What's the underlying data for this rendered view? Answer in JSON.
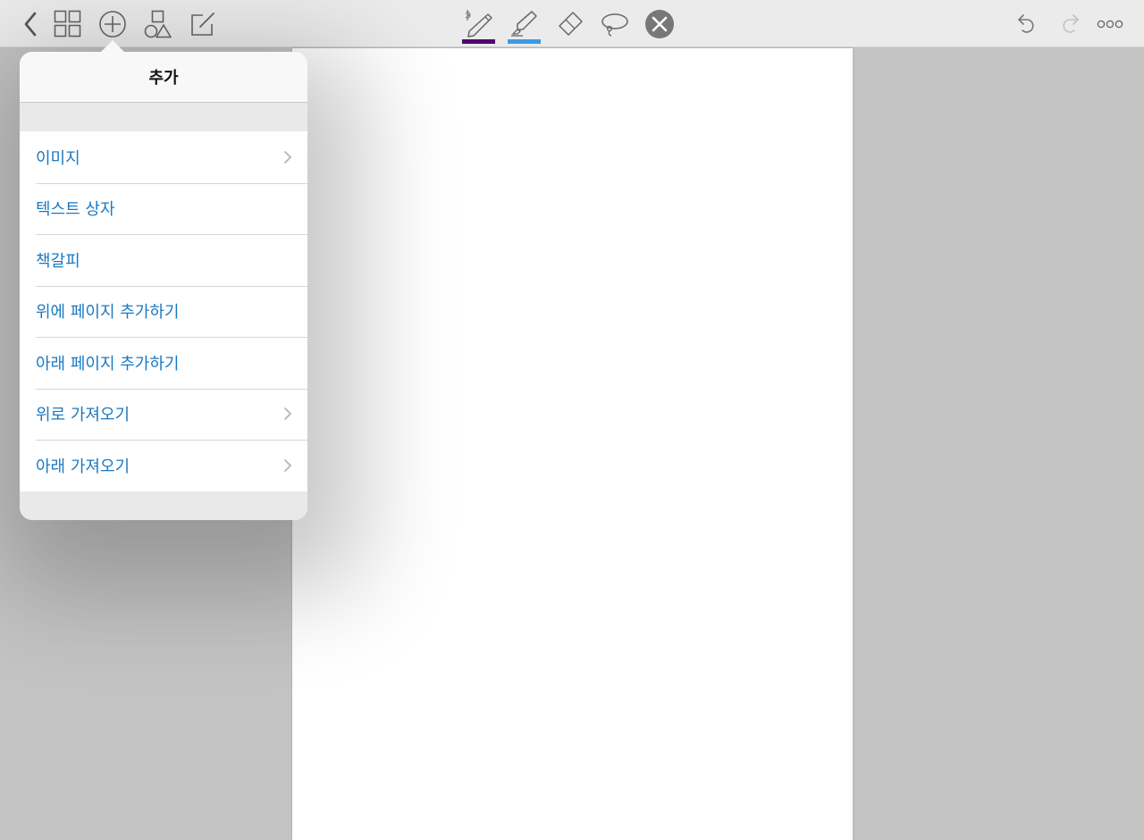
{
  "toolbar": {
    "left_icons": [
      "back-chevron-icon",
      "grid-icon",
      "add-circle-icon",
      "shapes-icon",
      "edit-note-icon"
    ],
    "pen_colors": {
      "pen": "#4b0a6e",
      "highlighter": "#3d9be2"
    },
    "right_icons": [
      "undo-icon",
      "redo-icon",
      "more-icon"
    ]
  },
  "popover": {
    "title": "추가",
    "items": [
      {
        "label": "이미지",
        "has_submenu": true
      },
      {
        "label": "텍스트 상자",
        "has_submenu": false
      },
      {
        "label": "책갈피",
        "has_submenu": false
      },
      {
        "label": "위에 페이지 추가하기",
        "has_submenu": false
      },
      {
        "label": "아래 페이지 추가하기",
        "has_submenu": false
      },
      {
        "label": "위로 가져오기",
        "has_submenu": true
      },
      {
        "label": "아래 가져오기",
        "has_submenu": true
      }
    ]
  },
  "colors": {
    "accent_text": "#1a79c2",
    "toolbar_bg": "#ebebeb",
    "workspace_bg": "#c3c3c3"
  }
}
